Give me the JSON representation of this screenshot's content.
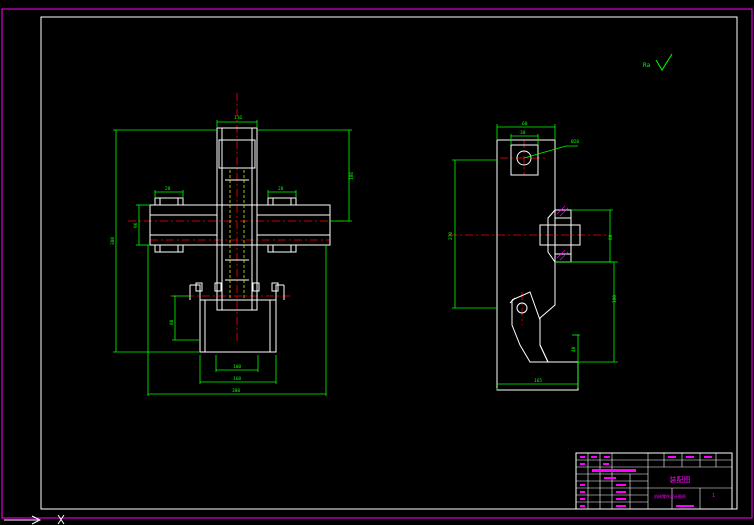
{
  "drawing": {
    "colors": {
      "background": "#000000",
      "outline": "#ffffff",
      "dimension": "#00ff00",
      "centerline": "#ff0000",
      "border": "#ff00ff",
      "leader": "#00ff00",
      "hidden": "#ffff00"
    },
    "roughness_symbol_text": "Ra",
    "left_view": {
      "dims": {
        "top_width": "116",
        "left_bolt": "28",
        "right_bolt": "28",
        "left_height": "96",
        "overall_height": "380",
        "right_height": "186",
        "lower_left": "80",
        "bottom_inner": "100",
        "bottom_mid": "160",
        "bottom_overall": "380"
      }
    },
    "right_view": {
      "dims": {
        "top_width": "60",
        "top_inner": "30",
        "bore_label": "Ø20",
        "overall_height": "270",
        "right_small": "80",
        "right_large": "180",
        "bottom_right": "40",
        "bottom_width": "165"
      }
    },
    "title_block": {
      "title": "装配图",
      "subtitle": "机械零件设计图纸",
      "sheet": "1"
    }
  }
}
